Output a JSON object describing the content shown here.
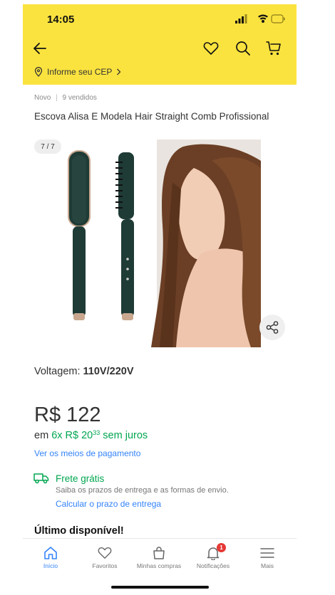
{
  "status_bar": {
    "time": "14:05"
  },
  "header": {
    "cep_label": "Informe seu CEP"
  },
  "product": {
    "condition": "Novo",
    "sold": "9 vendidos",
    "title": "Escova Alisa E Modela Hair Straight Comb Profissional",
    "image_counter": "7 / 7",
    "voltage_label": "Voltagem:",
    "voltage_value": "110V/220V",
    "price": "R$ 122",
    "installments_prefix": "em",
    "installments_count": "6x",
    "installment_value": "R$ 20",
    "installment_cents": "33",
    "installments_suffix": "sem juros",
    "payment_link": "Ver os meios de pagamento",
    "shipping_title": "Frete grátis",
    "shipping_subtitle": "Saiba os prazos de entrega e as formas de envio.",
    "shipping_link": "Calcular o prazo de entrega",
    "stock": "Último disponível!"
  },
  "tabbar": {
    "items": [
      {
        "label": "Início",
        "icon": "home-icon",
        "active": true
      },
      {
        "label": "Favoritos",
        "icon": "heart-icon"
      },
      {
        "label": "Minhas compras",
        "icon": "shopping-bag-icon"
      },
      {
        "label": "Notificações",
        "icon": "bell-icon",
        "badge": "1"
      },
      {
        "label": "Mais",
        "icon": "menu-icon"
      }
    ]
  },
  "colors": {
    "header_bg": "#fbe33f",
    "accent_blue": "#3483fa",
    "success_green": "#00a650",
    "badge_red": "#e53935"
  }
}
